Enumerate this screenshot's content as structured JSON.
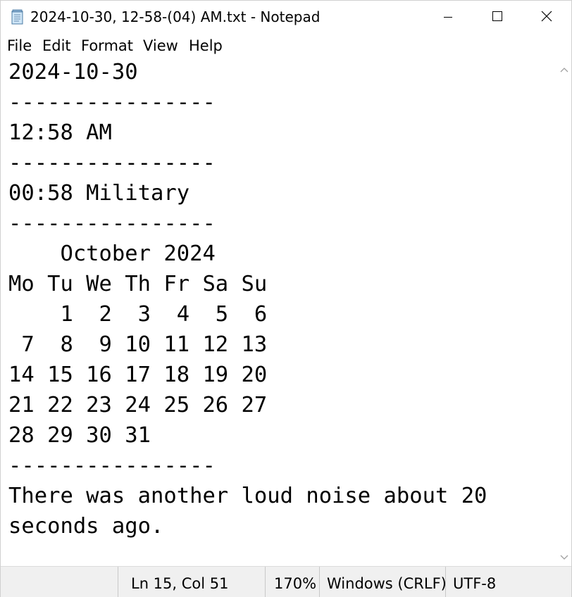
{
  "window": {
    "title": "2024-10-30, 12-58-(04) AM.txt - Notepad",
    "icon": "notepad-icon",
    "controls": [
      "minimize-icon",
      "maximize-icon",
      "close-icon"
    ]
  },
  "menu": {
    "file": "File",
    "edit": "Edit",
    "format": "Format",
    "view": "View",
    "help": "Help"
  },
  "editor": {
    "text": "2024-10-30\n----------------\n12:58 AM\n----------------\n00:58 Military\n----------------\n    October 2024\nMo Tu We Th Fr Sa Su\n    1  2  3  4  5  6\n 7  8  9 10 11 12 13\n14 15 16 17 18 19 20\n21 22 23 24 25 26 27\n28 29 30 31\n----------------\nThere was another loud noise about 20\nseconds ago."
  },
  "status": {
    "position": "Ln 15, Col 51",
    "zoom": "170%",
    "line_ending": "Windows (CRLF)",
    "encoding": "UTF-8"
  }
}
